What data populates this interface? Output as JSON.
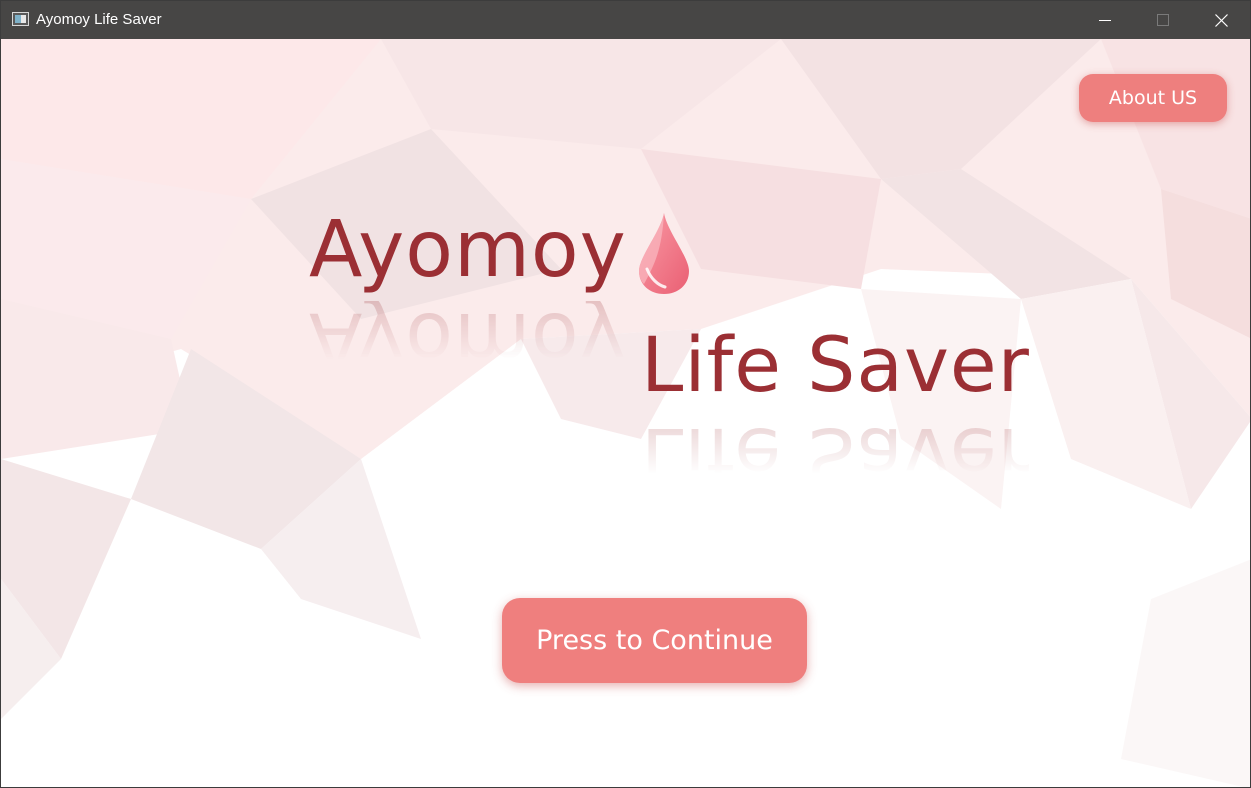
{
  "window": {
    "title": "Ayomoy Life Saver",
    "icon": "app-window-icon",
    "controls": [
      "minimize-icon",
      "maximize-icon",
      "close-icon"
    ]
  },
  "header": {
    "about_label": "About US"
  },
  "logo": {
    "word1": "Ayomoy",
    "word2": "Life Saver",
    "icon": "blood-drop-icon"
  },
  "main": {
    "continue_label": "Press to Continue"
  },
  "colors": {
    "titlebar": "#474645",
    "button": "#ef7f7e",
    "logo_text": "#9b2f34",
    "drop": "#f27a8a"
  }
}
